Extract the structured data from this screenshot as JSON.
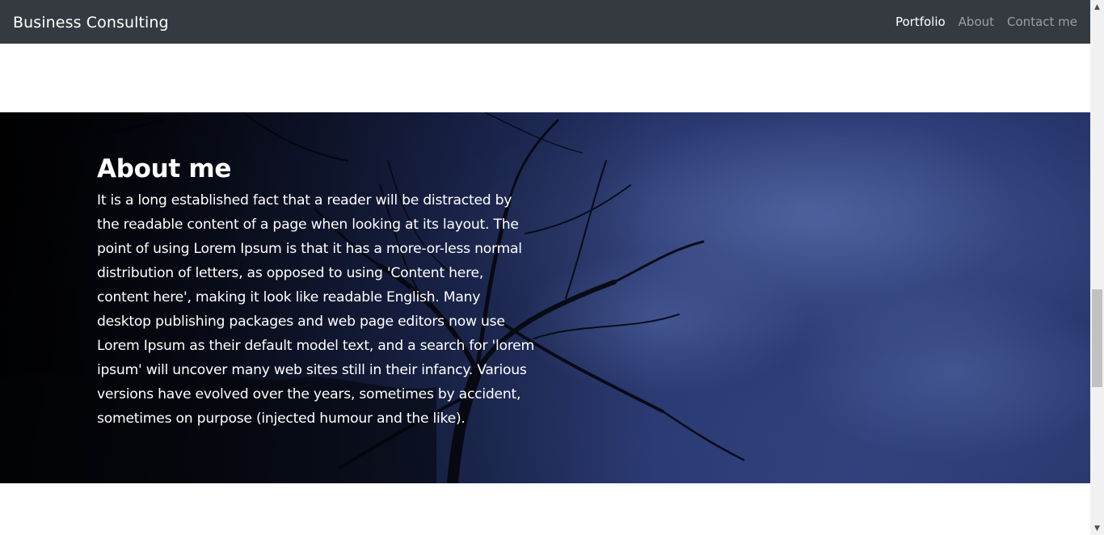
{
  "navbar": {
    "brand": "Business Consulting",
    "links": [
      {
        "label": "Portfolio",
        "active": true
      },
      {
        "label": "About",
        "active": false
      },
      {
        "label": "Contact me",
        "active": false
      }
    ]
  },
  "about": {
    "title": "About me",
    "text": "It is a long established fact that a reader will be distracted by the readable content of a page when looking at its layout. The point of using Lorem Ipsum is that it has a more-or-less normal distribution of letters, as opposed to using 'Content here, content here', making it look like readable English. Many desktop publishing packages and web page editors now use Lorem Ipsum as their default model text, and a search for 'lorem ipsum' will uncover many web sites still in their infancy. Various versions have evolved over the years, sometimes by accident, sometimes on purpose (injected humour and the like)."
  },
  "scrollbar": {
    "up_icon": "arrow-up-icon",
    "down_icon": "arrow-down-icon"
  },
  "colors": {
    "navbar_bg": "#343a40",
    "nav_active": "#ffffff",
    "nav_inactive": "rgba(255,255,255,0.5)"
  }
}
